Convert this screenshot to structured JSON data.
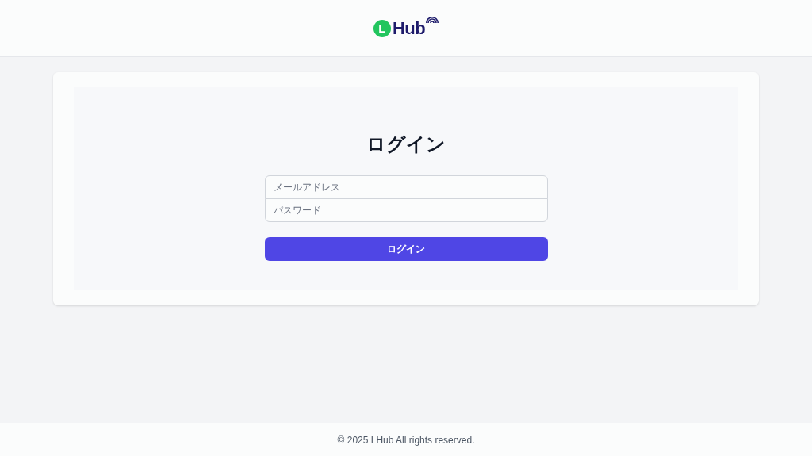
{
  "header": {
    "logo_mark": "L",
    "logo_text": "Hub"
  },
  "login": {
    "title": "ログイン",
    "fields": [
      {
        "placeholder": "メールアドレス"
      },
      {
        "placeholder": "パスワード"
      }
    ],
    "button": "ログイン"
  },
  "footer": "© 2025 LHub All rights reserved."
}
